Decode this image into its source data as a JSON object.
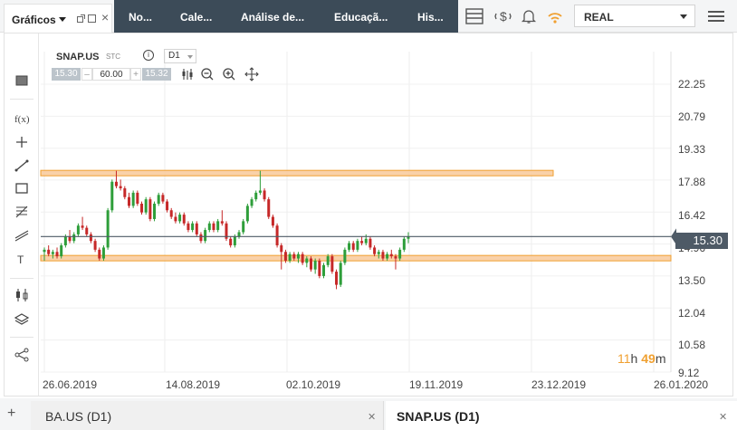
{
  "topbar": {
    "graficos_label": "Gráficos",
    "nav_items": [
      "No...",
      "Cale...",
      "Análise de...",
      "Educaçã...",
      "His..."
    ],
    "account_mode": "REAL"
  },
  "chart": {
    "symbol": "SNAP.US",
    "symbol_type": "STC",
    "timeframe": "D1",
    "bid": "15.30",
    "volume": "60.00",
    "ask": "15.32",
    "current_price_label": "15.30",
    "countdown_hours": "11",
    "countdown_h": "h",
    "countdown_minutes": "49",
    "countdown_m": "m"
  },
  "chart_data": {
    "type": "candlestick",
    "y_ticks": [
      "22.25",
      "20.79",
      "19.33",
      "17.88",
      "16.42",
      "14.96",
      "13.50",
      "12.04",
      "10.58",
      "9.12"
    ],
    "x_ticks": [
      "26.06.2019",
      "14.08.2019",
      "02.10.2019",
      "19.11.2019",
      "23.12.2019",
      "26.01.2020"
    ],
    "ylim": [
      9.12,
      22.25
    ],
    "current_price": 15.3,
    "zones": [
      {
        "low": 18.09,
        "high": 18.32
      },
      {
        "low": 14.2,
        "high": 14.44
      }
    ],
    "series": [
      {
        "o": 14.6,
        "h": 14.8,
        "l": 14.2,
        "c": 14.7
      },
      {
        "o": 14.7,
        "h": 14.9,
        "l": 14.4,
        "c": 14.5
      },
      {
        "o": 14.5,
        "h": 14.7,
        "l": 14.3,
        "c": 14.6
      },
      {
        "o": 14.6,
        "h": 14.8,
        "l": 14.3,
        "c": 14.4
      },
      {
        "o": 14.4,
        "h": 15.0,
        "l": 14.3,
        "c": 14.9
      },
      {
        "o": 14.9,
        "h": 15.4,
        "l": 14.8,
        "c": 15.3
      },
      {
        "o": 15.3,
        "h": 15.6,
        "l": 15.0,
        "c": 15.1
      },
      {
        "o": 15.1,
        "h": 15.5,
        "l": 15.0,
        "c": 15.4
      },
      {
        "o": 15.4,
        "h": 15.9,
        "l": 15.3,
        "c": 15.8
      },
      {
        "o": 15.8,
        "h": 16.2,
        "l": 15.6,
        "c": 15.7
      },
      {
        "o": 15.7,
        "h": 15.8,
        "l": 15.3,
        "c": 15.4
      },
      {
        "o": 15.4,
        "h": 15.5,
        "l": 15.0,
        "c": 15.1
      },
      {
        "o": 15.1,
        "h": 15.2,
        "l": 14.6,
        "c": 14.7
      },
      {
        "o": 14.7,
        "h": 14.8,
        "l": 14.2,
        "c": 14.3
      },
      {
        "o": 14.3,
        "h": 14.9,
        "l": 14.2,
        "c": 14.8
      },
      {
        "o": 14.8,
        "h": 16.6,
        "l": 14.7,
        "c": 16.5
      },
      {
        "o": 16.5,
        "h": 17.9,
        "l": 16.4,
        "c": 17.8
      },
      {
        "o": 17.8,
        "h": 18.3,
        "l": 17.5,
        "c": 17.6
      },
      {
        "o": 17.6,
        "h": 17.9,
        "l": 17.4,
        "c": 17.5
      },
      {
        "o": 17.5,
        "h": 17.6,
        "l": 17.0,
        "c": 17.1
      },
      {
        "o": 17.1,
        "h": 17.3,
        "l": 16.6,
        "c": 16.7
      },
      {
        "o": 16.7,
        "h": 17.4,
        "l": 16.6,
        "c": 17.3
      },
      {
        "o": 17.3,
        "h": 17.4,
        "l": 16.7,
        "c": 16.8
      },
      {
        "o": 16.8,
        "h": 16.9,
        "l": 16.3,
        "c": 16.4
      },
      {
        "o": 16.4,
        "h": 17.1,
        "l": 16.3,
        "c": 17.0
      },
      {
        "o": 17.0,
        "h": 17.1,
        "l": 16.0,
        "c": 16.1
      },
      {
        "o": 16.1,
        "h": 16.9,
        "l": 16.0,
        "c": 16.8
      },
      {
        "o": 16.8,
        "h": 17.3,
        "l": 16.7,
        "c": 17.2
      },
      {
        "o": 17.2,
        "h": 17.3,
        "l": 16.8,
        "c": 16.9
      },
      {
        "o": 16.9,
        "h": 17.0,
        "l": 16.4,
        "c": 16.5
      },
      {
        "o": 16.5,
        "h": 16.6,
        "l": 16.1,
        "c": 16.2
      },
      {
        "o": 16.2,
        "h": 16.4,
        "l": 15.9,
        "c": 16.0
      },
      {
        "o": 16.0,
        "h": 16.4,
        "l": 15.9,
        "c": 16.3
      },
      {
        "o": 16.3,
        "h": 16.4,
        "l": 15.8,
        "c": 15.9
      },
      {
        "o": 15.9,
        "h": 16.0,
        "l": 15.5,
        "c": 15.6
      },
      {
        "o": 15.6,
        "h": 16.0,
        "l": 15.5,
        "c": 15.9
      },
      {
        "o": 15.9,
        "h": 16.0,
        "l": 15.3,
        "c": 15.4
      },
      {
        "o": 15.4,
        "h": 15.5,
        "l": 15.0,
        "c": 15.1
      },
      {
        "o": 15.1,
        "h": 15.7,
        "l": 15.0,
        "c": 15.6
      },
      {
        "o": 15.6,
        "h": 16.0,
        "l": 15.5,
        "c": 15.9
      },
      {
        "o": 15.9,
        "h": 16.0,
        "l": 15.5,
        "c": 15.6
      },
      {
        "o": 15.6,
        "h": 16.1,
        "l": 15.5,
        "c": 16.0
      },
      {
        "o": 16.0,
        "h": 16.5,
        "l": 15.8,
        "c": 15.9
      },
      {
        "o": 15.9,
        "h": 16.0,
        "l": 15.1,
        "c": 15.2
      },
      {
        "o": 15.2,
        "h": 15.3,
        "l": 14.8,
        "c": 14.9
      },
      {
        "o": 14.9,
        "h": 15.4,
        "l": 14.8,
        "c": 15.3
      },
      {
        "o": 15.3,
        "h": 15.6,
        "l": 15.2,
        "c": 15.5
      },
      {
        "o": 15.5,
        "h": 16.1,
        "l": 15.4,
        "c": 16.0
      },
      {
        "o": 16.0,
        "h": 16.8,
        "l": 15.9,
        "c": 16.7
      },
      {
        "o": 16.7,
        "h": 17.1,
        "l": 16.6,
        "c": 17.0
      },
      {
        "o": 17.0,
        "h": 17.4,
        "l": 16.9,
        "c": 17.3
      },
      {
        "o": 17.3,
        "h": 18.3,
        "l": 17.2,
        "c": 17.4
      },
      {
        "o": 17.4,
        "h": 17.5,
        "l": 16.9,
        "c": 17.0
      },
      {
        "o": 17.0,
        "h": 17.1,
        "l": 16.1,
        "c": 16.2
      },
      {
        "o": 16.2,
        "h": 16.3,
        "l": 15.7,
        "c": 15.8
      },
      {
        "o": 15.8,
        "h": 15.9,
        "l": 14.8,
        "c": 14.9
      },
      {
        "o": 14.9,
        "h": 15.0,
        "l": 13.8,
        "c": 14.6
      },
      {
        "o": 14.6,
        "h": 14.7,
        "l": 14.1,
        "c": 14.2
      },
      {
        "o": 14.2,
        "h": 14.6,
        "l": 14.1,
        "c": 14.5
      },
      {
        "o": 14.5,
        "h": 14.6,
        "l": 14.2,
        "c": 14.3
      },
      {
        "o": 14.3,
        "h": 14.6,
        "l": 14.1,
        "c": 14.5
      },
      {
        "o": 14.5,
        "h": 14.6,
        "l": 14.0,
        "c": 14.1
      },
      {
        "o": 14.1,
        "h": 14.4,
        "l": 13.9,
        "c": 14.3
      },
      {
        "o": 14.3,
        "h": 14.4,
        "l": 13.7,
        "c": 13.8
      },
      {
        "o": 13.8,
        "h": 14.3,
        "l": 13.6,
        "c": 14.2
      },
      {
        "o": 14.2,
        "h": 14.3,
        "l": 13.4,
        "c": 13.5
      },
      {
        "o": 13.5,
        "h": 14.1,
        "l": 13.4,
        "c": 14.0
      },
      {
        "o": 14.0,
        "h": 14.5,
        "l": 13.9,
        "c": 14.4
      },
      {
        "o": 14.4,
        "h": 14.5,
        "l": 13.6,
        "c": 13.7
      },
      {
        "o": 13.7,
        "h": 13.8,
        "l": 12.9,
        "c": 13.1
      },
      {
        "o": 13.1,
        "h": 14.2,
        "l": 13.0,
        "c": 14.1
      },
      {
        "o": 14.1,
        "h": 14.8,
        "l": 14.0,
        "c": 14.7
      },
      {
        "o": 14.7,
        "h": 15.1,
        "l": 14.6,
        "c": 15.0
      },
      {
        "o": 15.0,
        "h": 15.1,
        "l": 14.6,
        "c": 14.7
      },
      {
        "o": 14.7,
        "h": 15.2,
        "l": 14.6,
        "c": 15.1
      },
      {
        "o": 15.1,
        "h": 15.3,
        "l": 14.9,
        "c": 15.0
      },
      {
        "o": 15.0,
        "h": 15.4,
        "l": 14.9,
        "c": 15.2
      },
      {
        "o": 15.2,
        "h": 15.3,
        "l": 14.7,
        "c": 14.8
      },
      {
        "o": 14.8,
        "h": 14.9,
        "l": 14.4,
        "c": 14.5
      },
      {
        "o": 14.5,
        "h": 14.7,
        "l": 14.3,
        "c": 14.6
      },
      {
        "o": 14.6,
        "h": 14.7,
        "l": 14.2,
        "c": 14.3
      },
      {
        "o": 14.3,
        "h": 14.6,
        "l": 14.2,
        "c": 14.5
      },
      {
        "o": 14.5,
        "h": 14.7,
        "l": 14.3,
        "c": 14.4
      },
      {
        "o": 14.4,
        "h": 14.5,
        "l": 13.8,
        "c": 14.3
      },
      {
        "o": 14.3,
        "h": 14.8,
        "l": 14.2,
        "c": 14.7
      },
      {
        "o": 14.7,
        "h": 15.3,
        "l": 14.6,
        "c": 15.2
      },
      {
        "o": 15.2,
        "h": 15.5,
        "l": 15.0,
        "c": 15.3
      }
    ]
  },
  "tabs": [
    {
      "label": "BA.US (D1)"
    },
    {
      "label": "SNAP.US (D1)"
    }
  ],
  "colors": {
    "accent": "#f0a030",
    "up": "#2e9e3a",
    "down": "#c62828",
    "zone": "#f8c99a",
    "nav": "#3c4b58"
  }
}
